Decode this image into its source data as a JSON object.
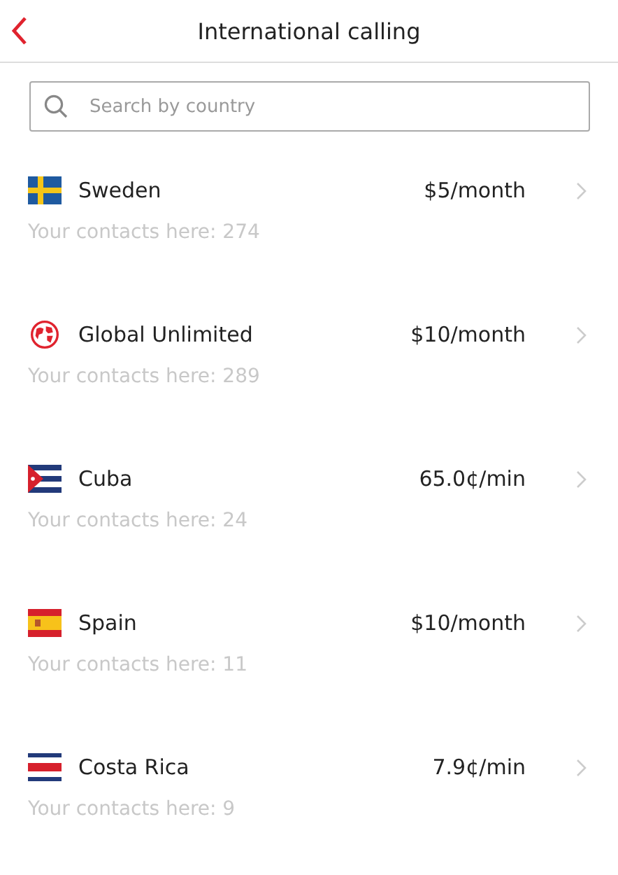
{
  "header": {
    "title": "International calling"
  },
  "search": {
    "placeholder": "Search by country"
  },
  "plans": [
    {
      "kind": "sweden",
      "name": "Sweden",
      "price": "$5/month",
      "contacts": "Your contacts here: 274"
    },
    {
      "kind": "globe",
      "name": "Global Unlimited",
      "price": "$10/month",
      "contacts": "Your contacts here: 289"
    },
    {
      "kind": "cuba",
      "name": "Cuba",
      "price": "65.0¢/min",
      "contacts": "Your contacts here: 24"
    },
    {
      "kind": "spain",
      "name": "Spain",
      "price": "$10/month",
      "contacts": "Your contacts here: 11"
    },
    {
      "kind": "costa-rica",
      "name": "Costa Rica",
      "price": "7.9¢/min",
      "contacts": "Your contacts here: 9"
    }
  ]
}
